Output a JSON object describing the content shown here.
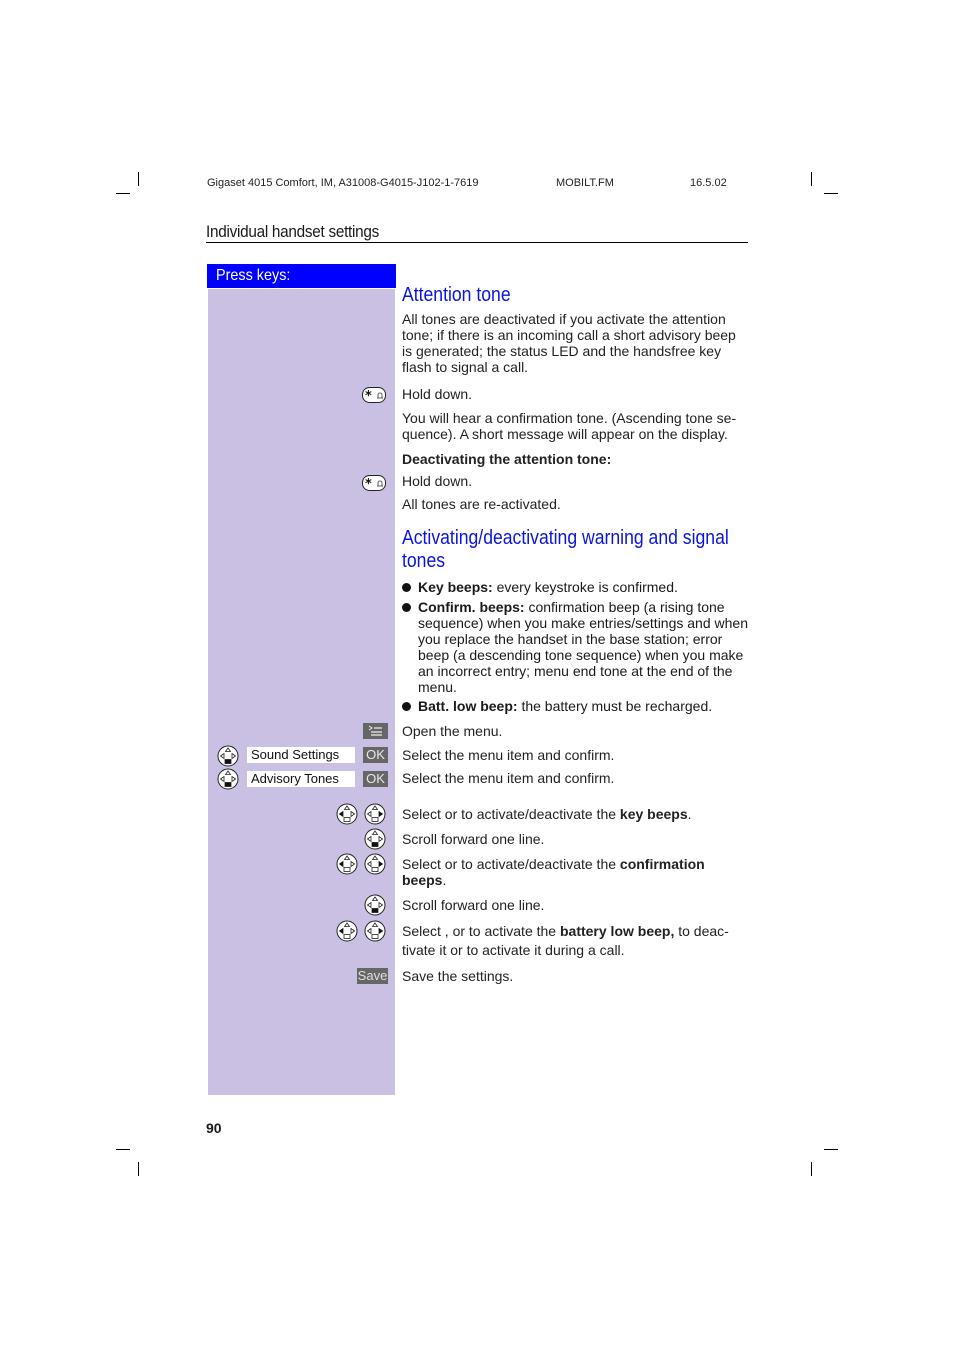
{
  "header": {
    "doc_id": "Gigaset 4015 Comfort, IM, A31008-G4015-J102-1-7619",
    "file": "MOBILT.FM",
    "date": "16.5.02"
  },
  "section_title": "Individual handset settings",
  "press_keys_label": "Press keys:",
  "attention": {
    "title": "Attention tone",
    "intro": [
      "All tones are deactivated if you activate the attention",
      "tone; if there is an incoming call a short advisory beep",
      "is generated; the status LED and the handsfree key",
      "flash to signal a call."
    ],
    "step1": "Hold down.",
    "step1_result": [
      "You will hear a confirmation tone. (Ascending tone se-",
      "quence). A short message will appear on the display."
    ],
    "deactivate_heading": "Deactivating the attention tone:",
    "step2": "Hold down.",
    "step2_result": "All tones are re-activated."
  },
  "warning": {
    "title_line1": "Activating/deactivating warning and signal",
    "title_line2": "tones",
    "bullets": [
      {
        "term": "Key beeps:",
        "text": " every keystroke is confirmed."
      },
      {
        "term": "Confirm. beeps:",
        "text": " confirmation beep (a rising tone sequence) when you make entries/settings and when you replace the handset in the base station; error beep (a descending tone sequence) when you make an incorrect entry; menu end tone at the end of the menu."
      },
      {
        "term": "Batt. low beep:",
        "text": " the battery must be recharged."
      }
    ]
  },
  "steps": {
    "open_menu": "Open the menu.",
    "menu_item_1": "Sound Settings",
    "menu_item_2": "Advisory Tones",
    "ok_label": "OK",
    "select_confirm_1": "Select the menu item and confirm.",
    "select_confirm_2": "Select the menu item and confirm.",
    "key_beeps_pre": "Select  or  to activate/deactivate the ",
    "key_beeps_bold": "key beeps",
    "key_beeps_post": ".",
    "scroll_1": "Scroll forward one line.",
    "confirm_pre": "Select  or  to activate/deactivate the ",
    "confirm_bold_1": "confirmation",
    "confirm_bold_2": "beeps",
    "confirm_post": ".",
    "scroll_2": "Scroll forward one line.",
    "battery_pre": "Select ,  or  to activate the ",
    "battery_bold": "battery low beep,",
    "battery_post": " to deac-",
    "battery_line2": "tivate it or to activate it during a call.",
    "save_label": "Save",
    "save_text": "Save the settings."
  },
  "page_number": "90",
  "colors": {
    "accent_blue": "#0a14dc",
    "press_header": "#0000ff",
    "key_column": "#c9c0e4",
    "softkey": "#666666"
  }
}
